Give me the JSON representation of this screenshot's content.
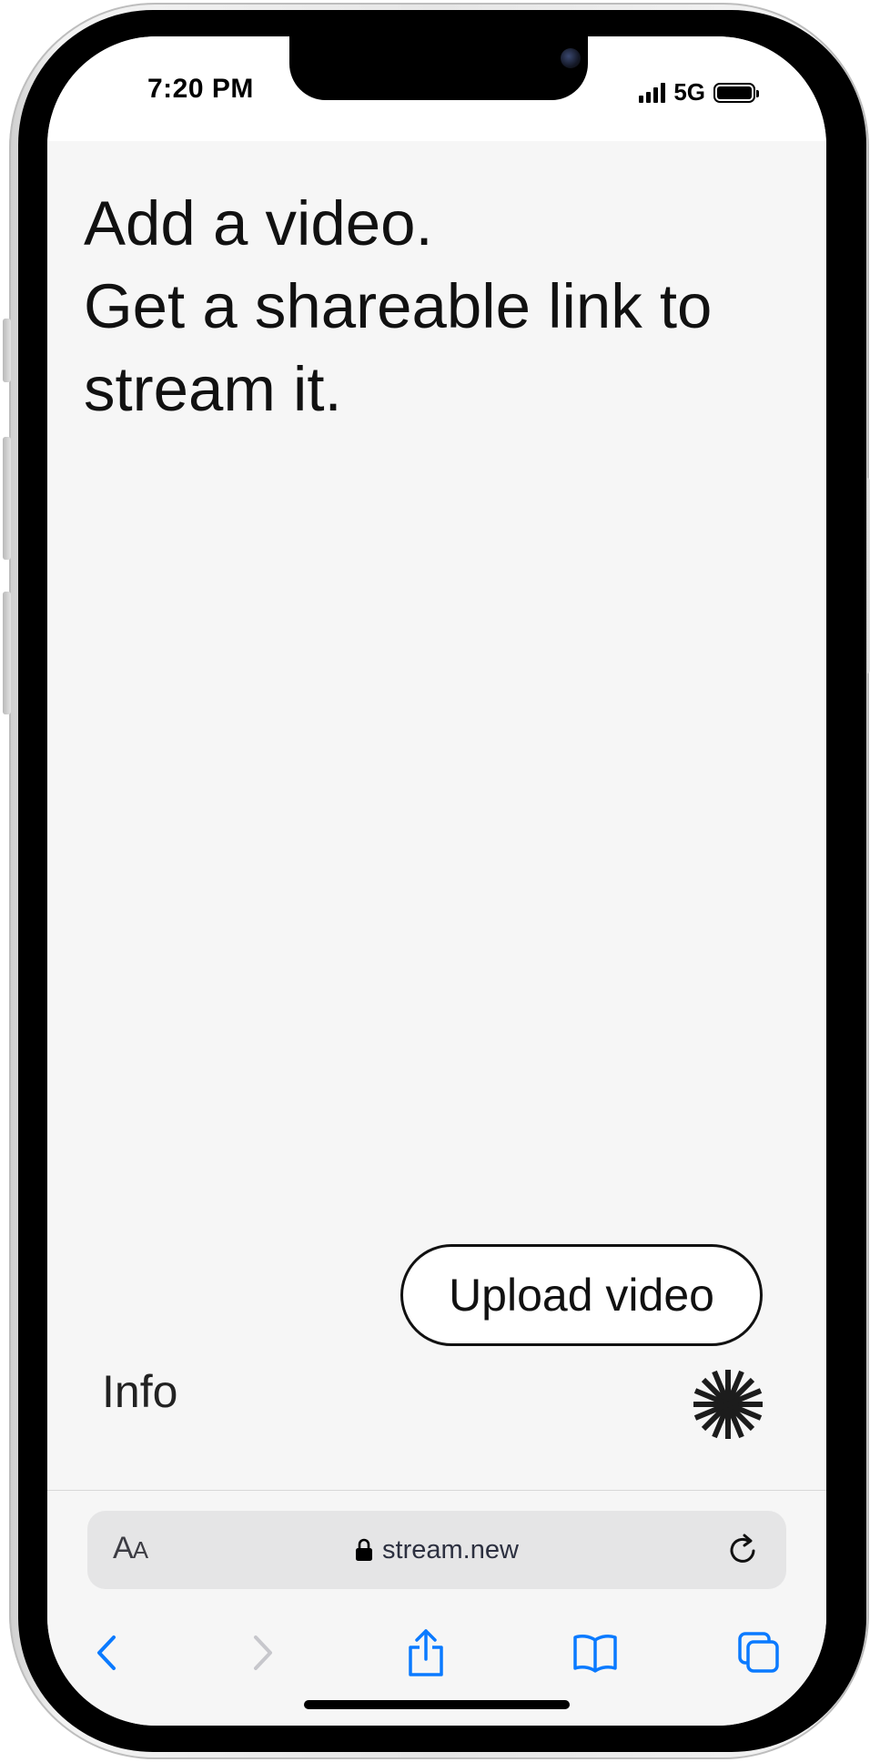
{
  "status_bar": {
    "time": "7:20 PM",
    "network": "5G",
    "icons": [
      "signal-bars-icon",
      "battery-icon"
    ]
  },
  "page": {
    "headline_lines": [
      "Add a video.",
      "Get a shareable link to",
      "stream it."
    ],
    "upload_button_label": "Upload video",
    "info_link_label": "Info",
    "logo_icon": "asterisk-star-icon"
  },
  "safari": {
    "text_size_label_large": "A",
    "text_size_label_small": "A",
    "url": "stream.new",
    "icons": {
      "lock": "lock-icon",
      "reload": "reload-icon",
      "back": "chevron-left-icon",
      "forward": "chevron-right-icon",
      "share": "share-icon",
      "bookmarks": "book-icon",
      "tabs": "tabs-icon"
    }
  },
  "colors": {
    "page_background": "#f6f6f6",
    "text": "#111111",
    "safari_accent": "#0a7aff",
    "disabled": "#c7c7cc",
    "address_bar": "#e5e5e6"
  }
}
